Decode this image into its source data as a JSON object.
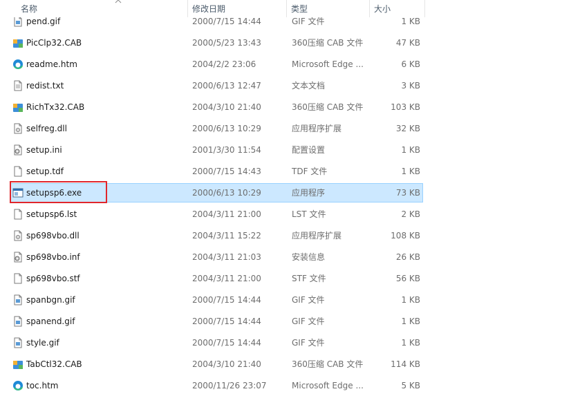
{
  "columns": {
    "name": "名称",
    "date": "修改日期",
    "type": "类型",
    "size": "大小"
  },
  "files": [
    {
      "name": "pend.gif",
      "date": "2000/7/15 14:44",
      "type": "GIF 文件",
      "size": "1 KB",
      "icon": "image-file-icon"
    },
    {
      "name": "PicClp32.CAB",
      "date": "2000/5/23 13:43",
      "type": "360压缩 CAB 文件",
      "size": "47 KB",
      "icon": "cab-archive-icon"
    },
    {
      "name": "readme.htm",
      "date": "2004/2/2 23:06",
      "type": "Microsoft Edge ...",
      "size": "6 KB",
      "icon": "edge-icon"
    },
    {
      "name": "redist.txt",
      "date": "2000/6/13 12:47",
      "type": "文本文档",
      "size": "3 KB",
      "icon": "text-file-icon"
    },
    {
      "name": "RichTx32.CAB",
      "date": "2004/3/10 21:40",
      "type": "360压缩 CAB 文件",
      "size": "103 KB",
      "icon": "cab-archive-icon"
    },
    {
      "name": "selfreg.dll",
      "date": "2000/6/13 10:29",
      "type": "应用程序扩展",
      "size": "32 KB",
      "icon": "dll-file-icon"
    },
    {
      "name": "setup.ini",
      "date": "2001/3/30 11:54",
      "type": "配置设置",
      "size": "1 KB",
      "icon": "config-file-icon"
    },
    {
      "name": "setup.tdf",
      "date": "2000/7/15 14:43",
      "type": "TDF 文件",
      "size": "1 KB",
      "icon": "blank-file-icon"
    },
    {
      "name": "setupsp6.exe",
      "date": "2000/6/13 10:29",
      "type": "应用程序",
      "size": "73 KB",
      "icon": "exe-file-icon",
      "selected": true
    },
    {
      "name": "setupsp6.lst",
      "date": "2004/3/11 21:00",
      "type": "LST 文件",
      "size": "2 KB",
      "icon": "blank-file-icon"
    },
    {
      "name": "sp698vbo.dll",
      "date": "2004/3/11 15:22",
      "type": "应用程序扩展",
      "size": "108 KB",
      "icon": "dll-file-icon"
    },
    {
      "name": "sp698vbo.inf",
      "date": "2004/3/11 21:03",
      "type": "安装信息",
      "size": "26 KB",
      "icon": "config-file-icon"
    },
    {
      "name": "sp698vbo.stf",
      "date": "2004/3/11 21:00",
      "type": "STF 文件",
      "size": "56 KB",
      "icon": "blank-file-icon"
    },
    {
      "name": "spanbgn.gif",
      "date": "2000/7/15 14:44",
      "type": "GIF 文件",
      "size": "1 KB",
      "icon": "image-file-icon"
    },
    {
      "name": "spanend.gif",
      "date": "2000/7/15 14:44",
      "type": "GIF 文件",
      "size": "1 KB",
      "icon": "image-file-icon"
    },
    {
      "name": "style.gif",
      "date": "2000/7/15 14:44",
      "type": "GIF 文件",
      "size": "1 KB",
      "icon": "image-file-icon"
    },
    {
      "name": "TabCtl32.CAB",
      "date": "2004/3/10 21:40",
      "type": "360压缩 CAB 文件",
      "size": "114 KB",
      "icon": "cab-archive-icon"
    },
    {
      "name": "toc.htm",
      "date": "2000/11/26 23:07",
      "type": "Microsoft Edge ...",
      "size": "5 KB",
      "icon": "edge-icon"
    }
  ],
  "colors": {
    "selection_bg": "#cce8ff",
    "selection_border": "#99d1ff",
    "annotation": "#e0262b",
    "header_text": "#4a5a6a",
    "meta_text": "#6d6d6d"
  }
}
